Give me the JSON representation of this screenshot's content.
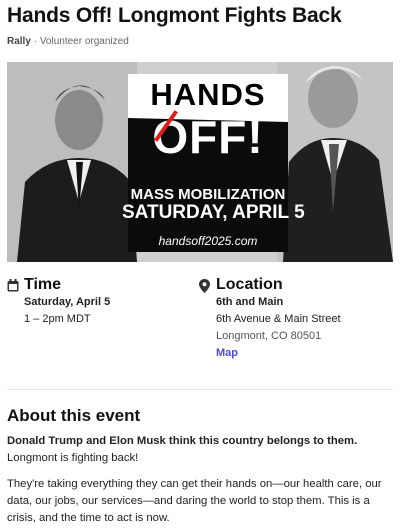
{
  "event": {
    "title": "Hands Off! Longmont Fights Back",
    "type": "Rally",
    "separator": "·",
    "organizer": "Volunteer organized"
  },
  "banner": {
    "headline_top": "HANDS",
    "headline_bottom": "OFF!",
    "line1": "MASS MOBILIZATION",
    "line2": "SATURDAY, APRIL 5",
    "url": "handsoff2025.com"
  },
  "time": {
    "icon": "calendar-icon",
    "heading": "Time",
    "date": "Saturday, April 5",
    "hours": "1 – 2pm MDT"
  },
  "location": {
    "icon": "map-pin-icon",
    "heading": "Location",
    "venue": "6th and Main",
    "address1": "6th Avenue & Main Street",
    "address2": "Longmont, CO 80501",
    "map_link": "Map"
  },
  "about": {
    "heading": "About this event",
    "lead": "Donald Trump and Elon Musk think this country belongs to them.",
    "lead_rest": "Longmont is fighting back!",
    "body": "They're taking everything they can get their hands on—our health care, our data, our jobs, our services—and daring the world to stop them. This is a crisis, and the time to act is now."
  },
  "colors": {
    "link": "#4b4fc4",
    "strike": "#d62020"
  }
}
